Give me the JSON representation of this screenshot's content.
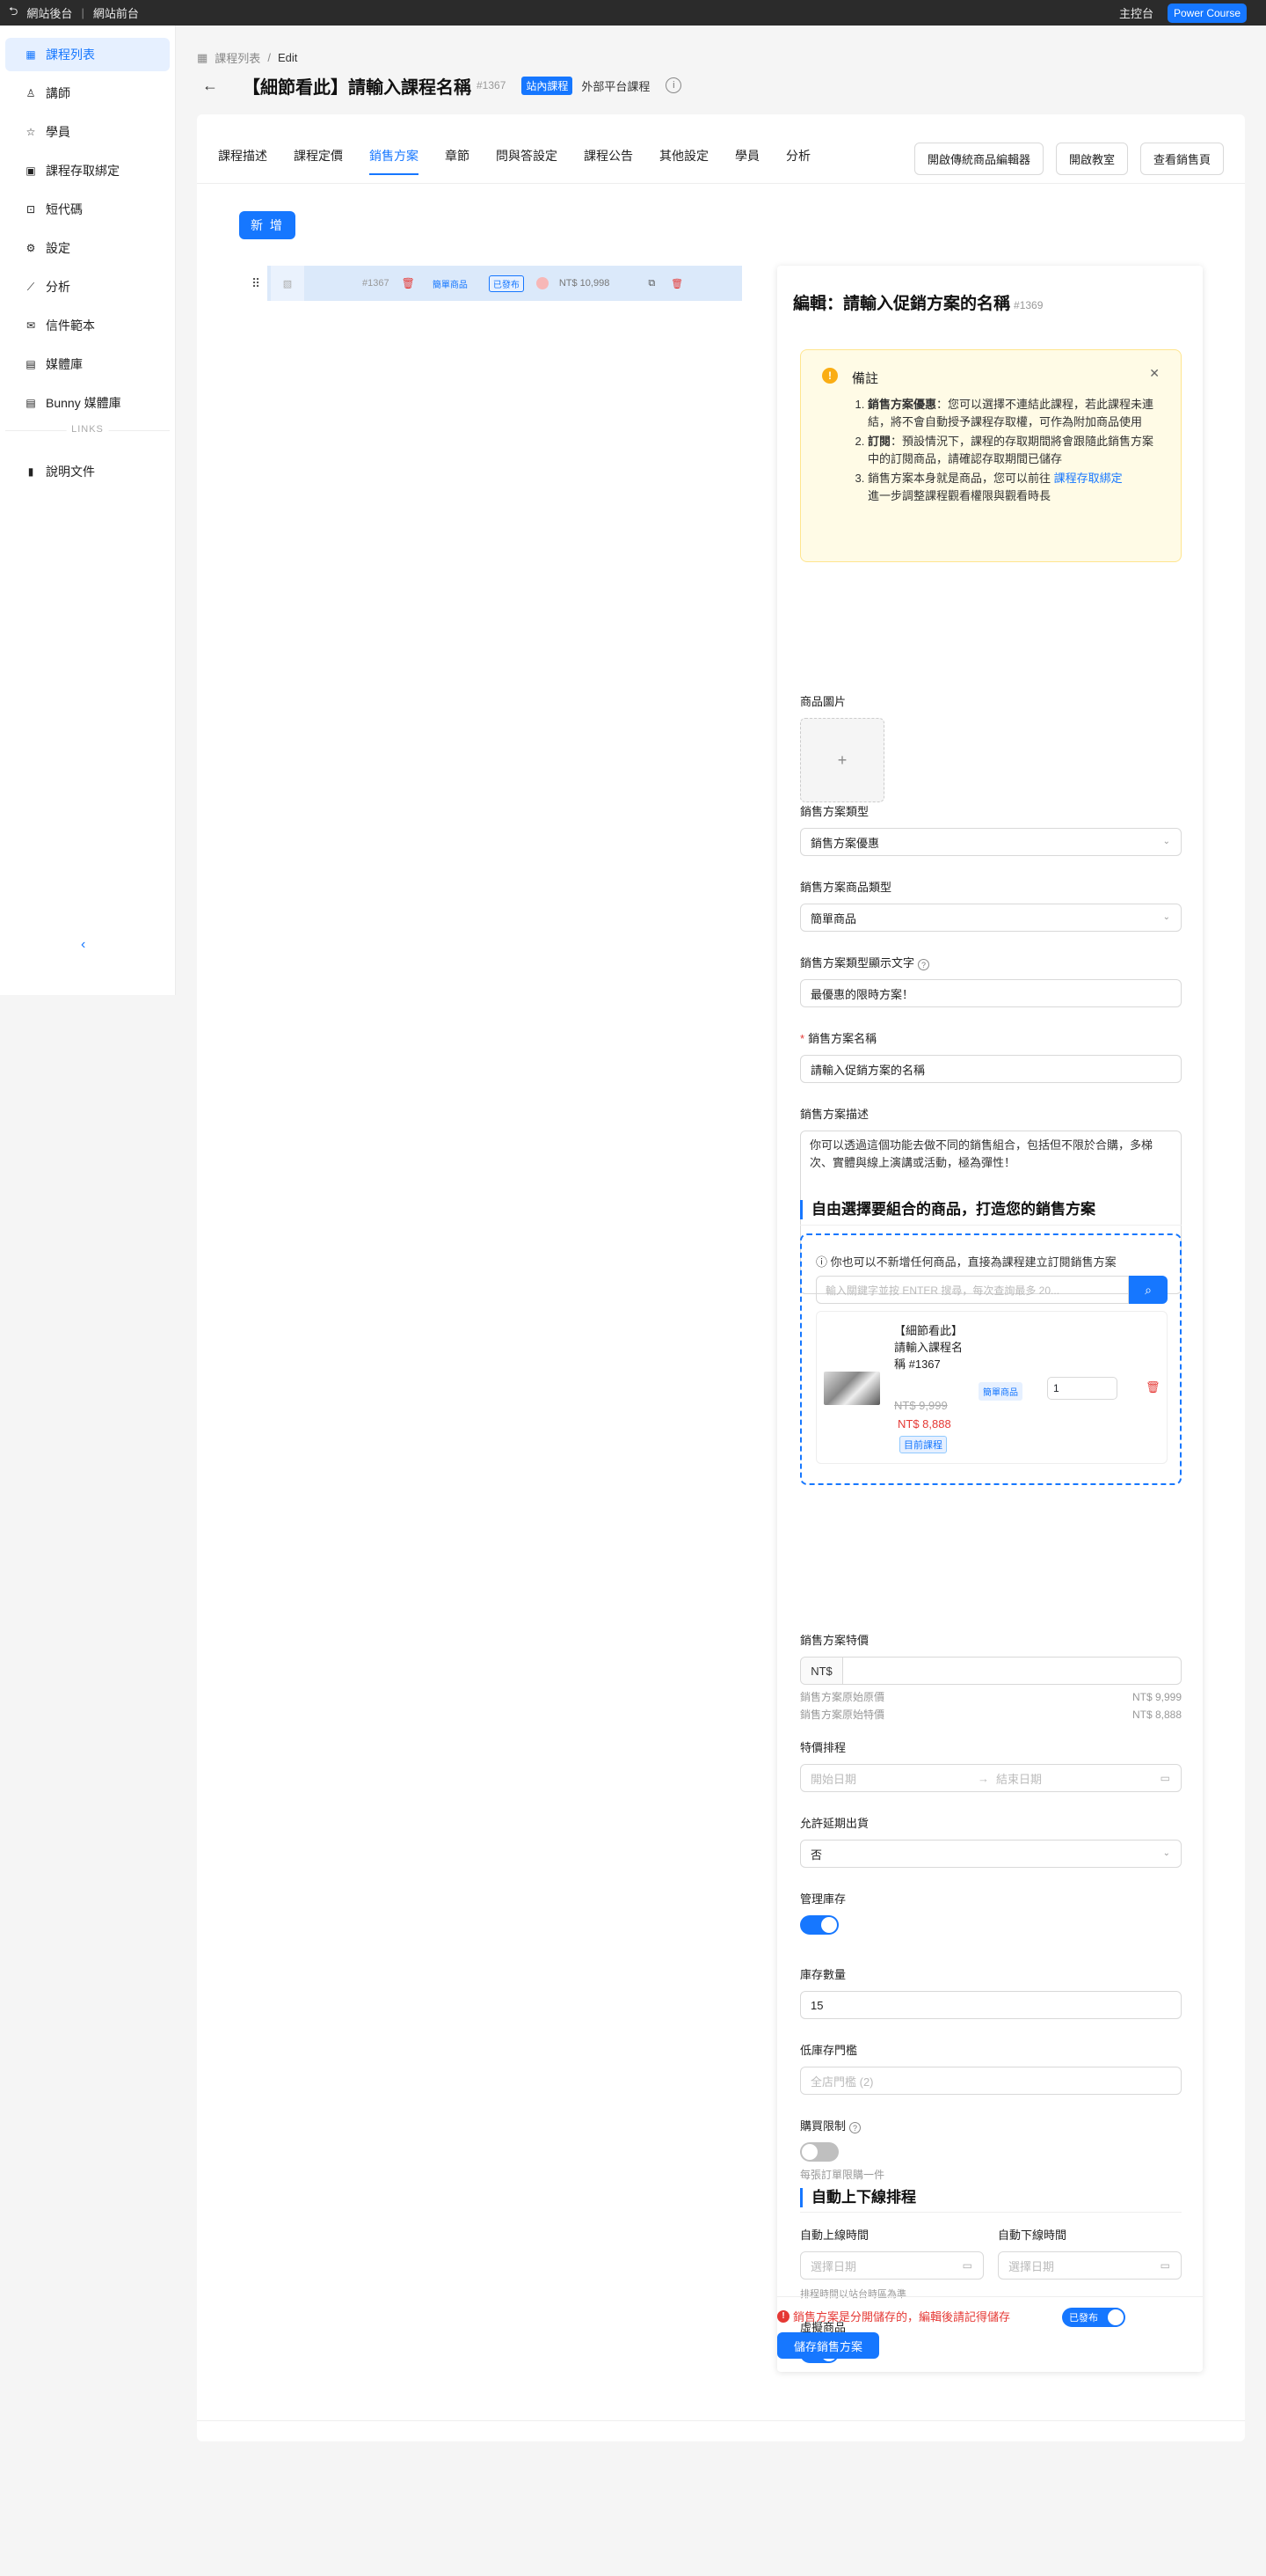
{
  "topbar": {
    "back_admin": "網站後台",
    "front": "網站前台",
    "console": "主控台",
    "brand": "Power Course"
  },
  "sidebar": {
    "items": [
      {
        "label": "課程列表",
        "icon": "table-icon"
      },
      {
        "label": "講師",
        "icon": "user-icon"
      },
      {
        "label": "學員",
        "icon": "graduation-icon"
      },
      {
        "label": "課程存取綁定",
        "icon": "apps-icon"
      },
      {
        "label": "短代碼",
        "icon": "code-icon"
      },
      {
        "label": "設定",
        "icon": "gear-icon"
      },
      {
        "label": "分析",
        "icon": "chart-icon"
      },
      {
        "label": "信件範本",
        "icon": "mail-icon"
      },
      {
        "label": "媒體庫",
        "icon": "media-icon"
      },
      {
        "label": "Bunny 媒體庫",
        "icon": "media-icon"
      }
    ],
    "links_label": "LINKS",
    "doc": "說明文件"
  },
  "breadcrumb": {
    "list": "課程列表",
    "sep": "/",
    "current": "Edit"
  },
  "header": {
    "title": "【細節看此】請輸入課程名稱",
    "id": "#1367",
    "tag_internal": "站內課程",
    "tag_external": "外部平台課程"
  },
  "tabs": [
    "課程描述",
    "課程定價",
    "銷售方案",
    "章節",
    "問與答設定",
    "課程公告",
    "其他設定",
    "學員",
    "分析"
  ],
  "actions": {
    "legacy_editor": "開啟傳統商品編輯器",
    "open_classroom": "開啟教室",
    "view_sales": "查看銷售頁"
  },
  "add_button": "新 增",
  "list_row": {
    "id": "#1367",
    "type": "簡單商品",
    "status": "已發布",
    "price": "NT$ 10,998"
  },
  "panel": {
    "title": "編輯：請輸入促銷方案的名稱",
    "id": "#1369",
    "note": {
      "title": "備註",
      "items": [
        {
          "bold": "銷售方案優惠",
          "text": "：您可以選擇不連結此課程，若此課程未連結，將不會自動授予課程存取權，可作為附加商品使用"
        },
        {
          "bold": "訂閱",
          "text": "：預設情況下，課程的存取期間將會跟隨此銷售方案中的訂閱商品，請確認存取期間已儲存"
        },
        {
          "text": "銷售方案本身就是商品，您可以前往 ",
          "link": "課程存取綁定",
          "tail": "進一步調整課程觀看權限與觀看時長"
        }
      ]
    },
    "image_label": "商品圖片",
    "type_label": "銷售方案類型",
    "type_value": "銷售方案優惠",
    "product_type_label": "銷售方案商品類型",
    "product_type_value": "簡單商品",
    "display_text_label": "銷售方案類型顯示文字",
    "display_text_value": "最優惠的限時方案！",
    "name_label": "銷售方案名稱",
    "name_value": "請輸入促銷方案的名稱",
    "desc_label": "銷售方案描述",
    "desc_value": "你可以透過這個功能去做不同的銷售組合，包括但不限於合購，多梯次、實體與線上演講或活動，極為彈性！",
    "bundle_heading": "自由選擇要組合的商品，打造您的銷售方案",
    "bundle_hint": "你也可以不新增任何商品，直接為課程建立訂閱銷售方案",
    "search_placeholder": "輸入關鍵字並按 ENTER 搜尋，每次查詢最多 20...",
    "bundle_item": {
      "name": "【細節看此】請輸入課程名稱 #1367",
      "old_price": "NT$ 9,999",
      "new_price": "NT$ 8,888",
      "current": "目前課程",
      "type": "簡單商品",
      "qty": "1"
    },
    "sale_price_label": "銷售方案特價",
    "currency": "NT$",
    "orig_price_label": "銷售方案原始原價",
    "orig_price_value": "NT$ 9,999",
    "orig_sale_label": "銷售方案原始特價",
    "orig_sale_value": "NT$ 8,888",
    "schedule_label": "特價排程",
    "start_ph": "開始日期",
    "end_ph": "結束日期",
    "backorder_label": "允許延期出貨",
    "backorder_value": "否",
    "manage_stock_label": "管理庫存",
    "manage_stock": true,
    "stock_qty_label": "庫存數量",
    "stock_qty_value": "15",
    "low_stock_label": "低庫存門檻",
    "low_stock_ph": "全店門檻 (2)",
    "purchase_limit_label": "購買限制",
    "purchase_limit": false,
    "purchase_limit_hint": "每張訂單限購一件",
    "auto_heading": "自動上下線排程",
    "auto_on_label": "自動上線時間",
    "auto_off_label": "自動下線時間",
    "date_ph": "選擇日期",
    "tz_hint": "排程時間以站台時區為準",
    "virtual_label": "虛擬商品",
    "virtual": true,
    "footer_error": "銷售方案是分開儲存的，編輯後請記得儲存",
    "published": "已發布",
    "save": "儲存銷售方案"
  }
}
